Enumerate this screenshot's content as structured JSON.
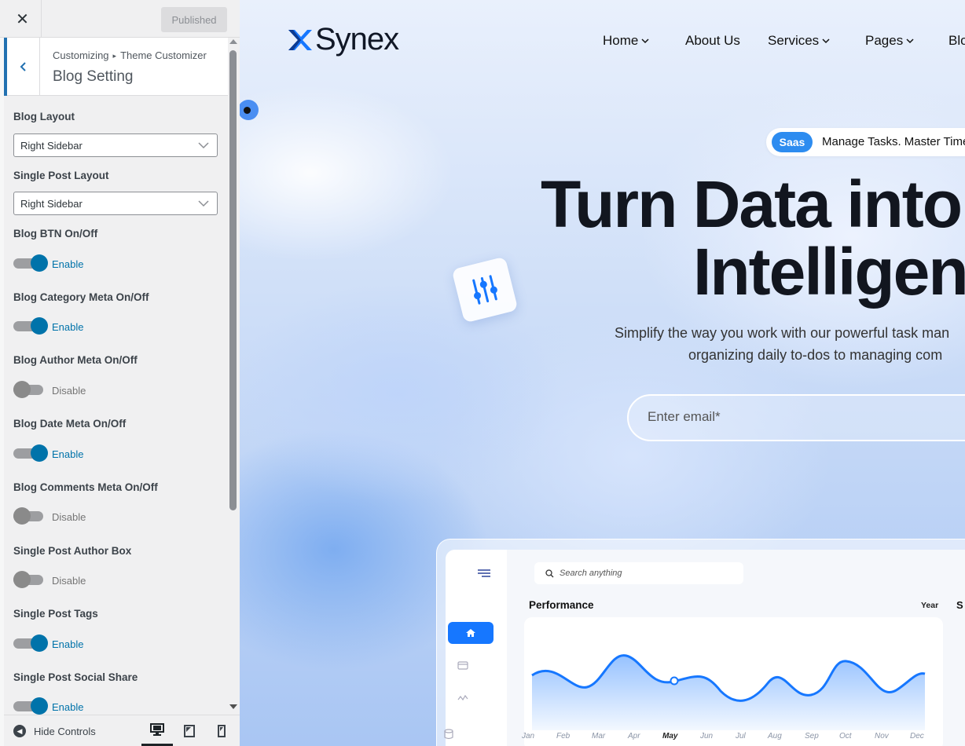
{
  "customizer": {
    "close_label": "✕",
    "publish_label": "Published",
    "breadcrumb": {
      "root": "Customizing",
      "separator": "▸",
      "parent": "Theme Customizer"
    },
    "section_title": "Blog Setting",
    "controls": {
      "blog_layout": {
        "label": "Blog Layout",
        "value": "Right Sidebar"
      },
      "single_post_layout": {
        "label": "Single Post Layout",
        "value": "Right Sidebar"
      },
      "toggles": [
        {
          "label": "Blog BTN On/Off",
          "state": "Enable",
          "on": true
        },
        {
          "label": "Blog Category Meta On/Off",
          "state": "Enable",
          "on": true
        },
        {
          "label": "Blog Author Meta On/Off",
          "state": "Disable",
          "on": false
        },
        {
          "label": "Blog Date Meta On/Off",
          "state": "Enable",
          "on": true
        },
        {
          "label": "Blog Comments Meta On/Off",
          "state": "Disable",
          "on": false
        },
        {
          "label": "Single Post Author Box",
          "state": "Disable",
          "on": false
        },
        {
          "label": "Single Post Tags",
          "state": "Enable",
          "on": true
        },
        {
          "label": "Single Post Social Share",
          "state": "Enable",
          "on": true
        }
      ]
    },
    "footer": {
      "hide_controls": "Hide Controls",
      "devices": [
        "desktop-icon",
        "tablet-icon",
        "mobile-icon"
      ],
      "active_device": "desktop"
    },
    "colors": {
      "accent": "#2271b1",
      "toggle_on": "#0073aa"
    }
  },
  "preview": {
    "logo": "Synex",
    "nav": [
      "Home",
      "About Us",
      "Services",
      "Pages",
      "Blo"
    ],
    "badge": {
      "pill": "Saas",
      "text": "Manage Tasks. Master Time"
    },
    "headline": {
      "line1": "Turn Data into B",
      "line2": "Intelligenc"
    },
    "subtext": {
      "line1": "Simplify the way you work with our powerful task man",
      "line2": "organizing daily to-dos to managing com"
    },
    "email_placeholder": "Enter email*",
    "dashboard": {
      "search_placeholder": "Search anything",
      "title": "Performance",
      "filter": "Year",
      "right_cut": "S",
      "months": [
        "Jan",
        "Feb",
        "Mar",
        "Apr",
        "May",
        "Jun",
        "Jul",
        "Aug",
        "Sep",
        "Oct",
        "Nov",
        "Dec"
      ],
      "highlight_month": "May"
    },
    "colors": {
      "brand": "#1677ff",
      "text": "#12161f"
    }
  }
}
